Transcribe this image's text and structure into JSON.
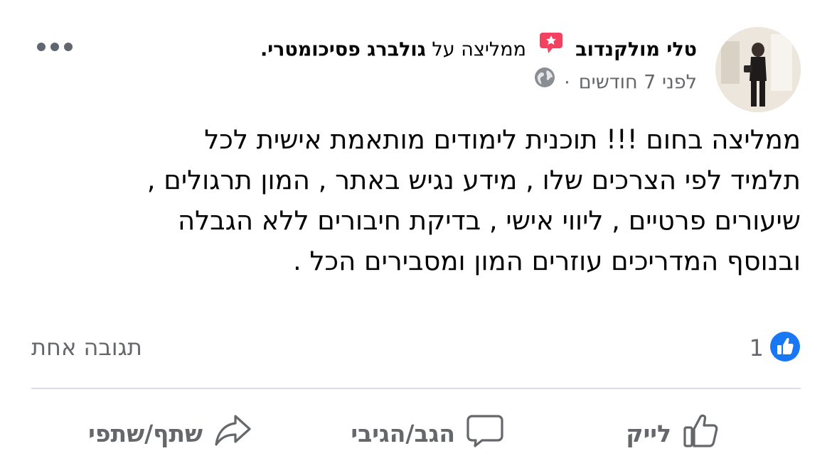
{
  "post": {
    "author": "טלי מולקנדוב",
    "recommends_text": "ממליצה על",
    "page_name": "גולברג פסיכומטרי.",
    "time_ago": "לפני 7 חודשים",
    "separator": "·",
    "privacy_icon": "globe-icon",
    "more_icon": "more-options-icon",
    "text": "ממליצה בחום !!!  תוכנית לימודים מותאמת אישית לכל\nתלמיד לפי הצרכים שלו  , מידע נגיש באתר , המון תרגולים ,\nשיעורים פרטיים  , ליווי אישי  , בדיקת חיבורים ללא הגבלה\nובנוסף המדריכים עוזרים המון ומסבירים הכל ."
  },
  "reactions": {
    "icon": "like-reaction-icon",
    "count": "1",
    "comments_label": "תגובה אחת"
  },
  "actions": {
    "like": {
      "label": "לייק",
      "icon": "thumbs-up-icon"
    },
    "comment": {
      "label": "הגב/הגיבי",
      "icon": "comment-icon"
    },
    "share": {
      "label": "שתף/שתפי",
      "icon": "share-icon"
    }
  },
  "colors": {
    "recommend_badge": "#f3425f",
    "like_blue": "#1877f2",
    "secondary_text": "#65676b",
    "divider": "#dadde1"
  }
}
